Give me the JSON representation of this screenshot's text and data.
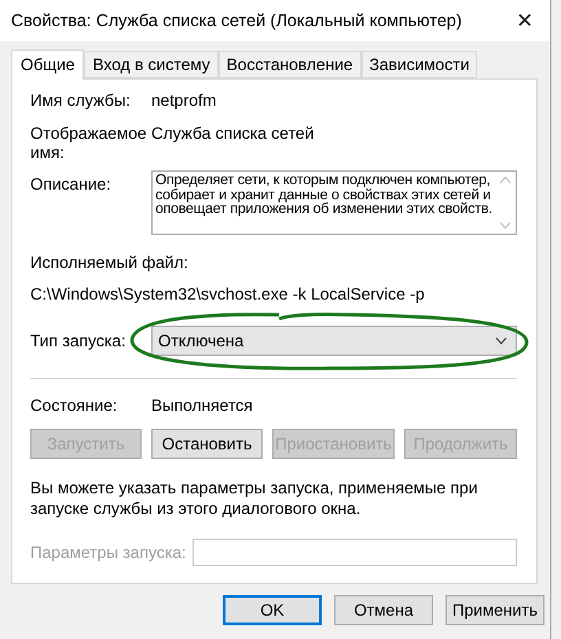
{
  "window": {
    "title": "Свойства: Служба списка сетей (Локальный компьютер)",
    "close": "✕"
  },
  "tabs": [
    {
      "label": "Общие",
      "selected": true
    },
    {
      "label": "Вход в систему",
      "selected": false
    },
    {
      "label": "Восстановление",
      "selected": false
    },
    {
      "label": "Зависимости",
      "selected": false
    }
  ],
  "general": {
    "service_name": {
      "label": "Имя службы:",
      "value": "netprofm"
    },
    "display_name": {
      "label": "Отображаемое имя:",
      "value": "Служба списка сетей"
    },
    "description": {
      "label": "Описание:",
      "value": "Определяет сети, к которым подключен компьютер, собирает и хранит данные о свойствах этих сетей и оповещает приложения об изменении этих свойств."
    },
    "executable": {
      "label": "Исполняемый файл:",
      "value": "C:\\Windows\\System32\\svchost.exe -k LocalService -p"
    },
    "startup_type": {
      "label": "Тип запуска:",
      "value": "Отключена",
      "highlighted": true
    },
    "status": {
      "label": "Состояние:",
      "value": "Выполняется"
    },
    "service_buttons": [
      {
        "label": "Запустить",
        "disabled": true
      },
      {
        "label": "Остановить",
        "disabled": false
      },
      {
        "label": "Приостановить",
        "disabled": true
      },
      {
        "label": "Продолжить",
        "disabled": true
      }
    ],
    "hint": "Вы можете указать параметры запуска, применяемые при запуске службы из этого диалогового окна.",
    "start_parameters": {
      "label": "Параметры запуска:",
      "disabled": true
    }
  },
  "dialog_buttons": [
    {
      "label": "OK",
      "default": true
    },
    {
      "label": "Отмена",
      "default": false
    },
    {
      "label": "Применить",
      "default": false
    }
  ]
}
